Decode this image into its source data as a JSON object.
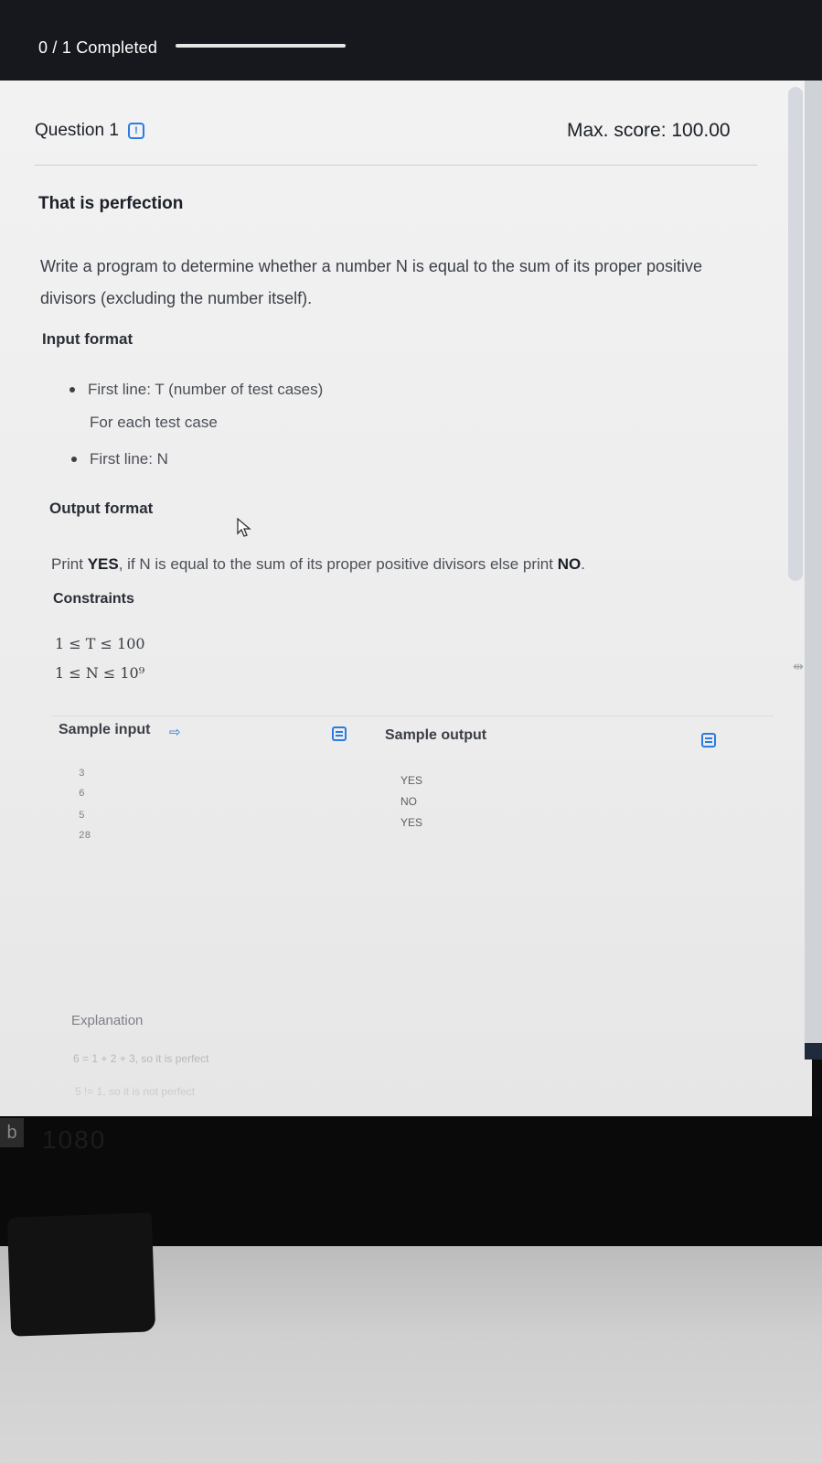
{
  "header": {
    "progress_label": "0 / 1 Completed",
    "progress_value": 1.0
  },
  "question": {
    "label": "Question 1",
    "max_score": "Max. score: 100.00",
    "title": "That is perfection",
    "description": "Write a program to determine whether a number N is equal to the sum of its proper positive divisors (excluding the number itself)."
  },
  "input_format": {
    "heading": "Input format",
    "line1": "First line: T (number of test cases)",
    "sub": "For each test case",
    "line2": "First line: N"
  },
  "output_format": {
    "heading": "Output format",
    "text_pre": "Print ",
    "yes": "YES",
    "text_mid": ", if N is equal to the sum of its proper positive divisors else print ",
    "no": "NO",
    "text_end": "."
  },
  "constraints": {
    "heading": "Constraints",
    "c1": "1 ≤ T ≤ 100",
    "c2": "1 ≤ N ≤ 10⁹"
  },
  "samples": {
    "input_label": "Sample input",
    "output_label": "Sample output",
    "input_lines": [
      "3",
      "6",
      "5",
      "28"
    ],
    "output_lines": [
      "YES",
      "NO",
      "YES"
    ]
  },
  "explanation": {
    "heading": "Explanation",
    "line1": "6 = 1 + 2 + 3, so it is perfect",
    "line2": "5 != 1, so it is not perfect"
  },
  "bezel": {
    "badge": "b",
    "text": "1080"
  },
  "colors": {
    "accent": "#2c7be5",
    "topbar": "#16181d"
  }
}
